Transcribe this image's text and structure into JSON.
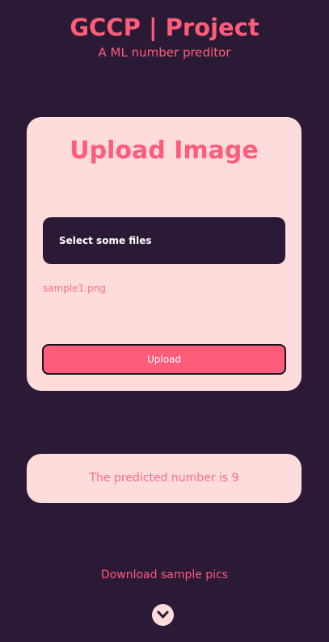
{
  "header": {
    "title": "GCCP | Project",
    "subtitle": "A ML number preditor"
  },
  "upload_card": {
    "title": "Upload Image",
    "file_picker_label": "Select some files",
    "selected_file": "sample1.png",
    "upload_label": "Upload"
  },
  "result": {
    "text": "The predicted number is 9"
  },
  "footer": {
    "download_label": "Download sample pics",
    "scroll_icon": "chevron-down-icon"
  },
  "colors": {
    "background": "#2b1a35",
    "accent": "#ff5c7a",
    "card": "#ffdcdc"
  }
}
